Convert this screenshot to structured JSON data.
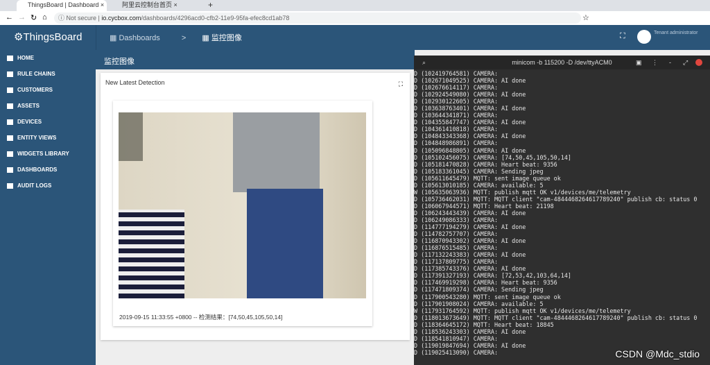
{
  "browser": {
    "tabs": [
      {
        "label": "ThingsBoard | Dashboard"
      },
      {
        "label": "阿里云控制台首页"
      }
    ],
    "security": "Not secure",
    "url_host": "io.cycbox.com",
    "url_path": "/dashboards/4296acd0-cfb2-11e9-95fa-efec8cd1ab78"
  },
  "header": {
    "logo": "ThingsBoard",
    "breadcrumb": [
      "Dashboards",
      ">",
      "监控图像"
    ],
    "user": "Tenant administrator"
  },
  "sidebar": {
    "items": [
      {
        "label": "HOME"
      },
      {
        "label": "RULE CHAINS"
      },
      {
        "label": "CUSTOMERS"
      },
      {
        "label": "ASSETS"
      },
      {
        "label": "DEVICES"
      },
      {
        "label": "ENTITY VIEWS"
      },
      {
        "label": "WIDGETS LIBRARY"
      },
      {
        "label": "DASHBOARDS"
      },
      {
        "label": "AUDIT LOGS"
      }
    ]
  },
  "dashboard": {
    "title": "监控图像",
    "widget_title": "New Latest Detection",
    "caption": "2019-09-15 11:33:55 +0800 -- 检测结果：[74,50,45,105,50,14]"
  },
  "terminal": {
    "title": "minicom -b 115200 -D /dev/ttyACM0",
    "lines": [
      "D (102419764581) CAMERA:",
      "D (102671049525) CAMERA: AI done",
      "D (102676614117) CAMERA:",
      "D (102924549080) CAMERA: AI done",
      "D (102930122605) CAMERA:",
      "D (103638763401) CAMERA: AI done",
      "D (103644341871) CAMERA:",
      "D (104355847747) CAMERA: AI done",
      "D (104361410818) CAMERA:",
      "D (104843343368) CAMERA: AI done",
      "D (104848986891) CAMERA:",
      "D (105096848805) CAMERA: AI done",
      "D (105102456075) CAMERA: [74,50,45,105,50,14]",
      "D (105181470828) CAMERA: Heart beat: 9356",
      "D (105183361045) CAMERA: Sending jpeg",
      "D (105611645479) MQTT: sent image queue ok",
      "D (105613010185) CAMERA: available: 5",
      "W (105635063936) MQTT: publish mqtt OK v1/devices/me/telemetry",
      "D (105736462031) MQTT: MQTT client \"cam-4844468264617789240\" publish cb: status 0",
      "D (106067944571) MQTT: Heart beat: 21198",
      "D (106243443439) CAMERA: AI done",
      "D (106249086333) CAMERA:",
      "D (114777194279) CAMERA: AI done",
      "D (114782757707) CAMERA:",
      "D (116870943302) CAMERA: AI done",
      "D (116876515485) CAMERA:",
      "D (117132243383) CAMERA: AI done",
      "D (117137809775) CAMERA:",
      "D (117385743376) CAMERA: AI done",
      "D (117391327193) CAMERA: [72,53,42,103,64,14]",
      "D (117469919298) CAMERA: Heart beat: 9356",
      "D (117471809374) CAMERA: Sending jpeg",
      "D (117900543280) MQTT: sent image queue ok",
      "D (117901908024) CAMERA: available: 5",
      "W (117931764592) MQTT: publish mqtt OK v1/devices/me/telemetry",
      "D (118013673649) MQTT: MQTT client \"cam-4844468264617789240\" publish cb: status 0",
      "D (118364645172) MQTT: Heart beat: 18845",
      "D (118536243303) CAMERA: AI done",
      "D (118541810947) CAMERA:",
      "D (119019847694) CAMERA: AI done",
      "D (119025413090) CAMERA:"
    ]
  },
  "watermark": "CSDN @Mdc_stdio"
}
